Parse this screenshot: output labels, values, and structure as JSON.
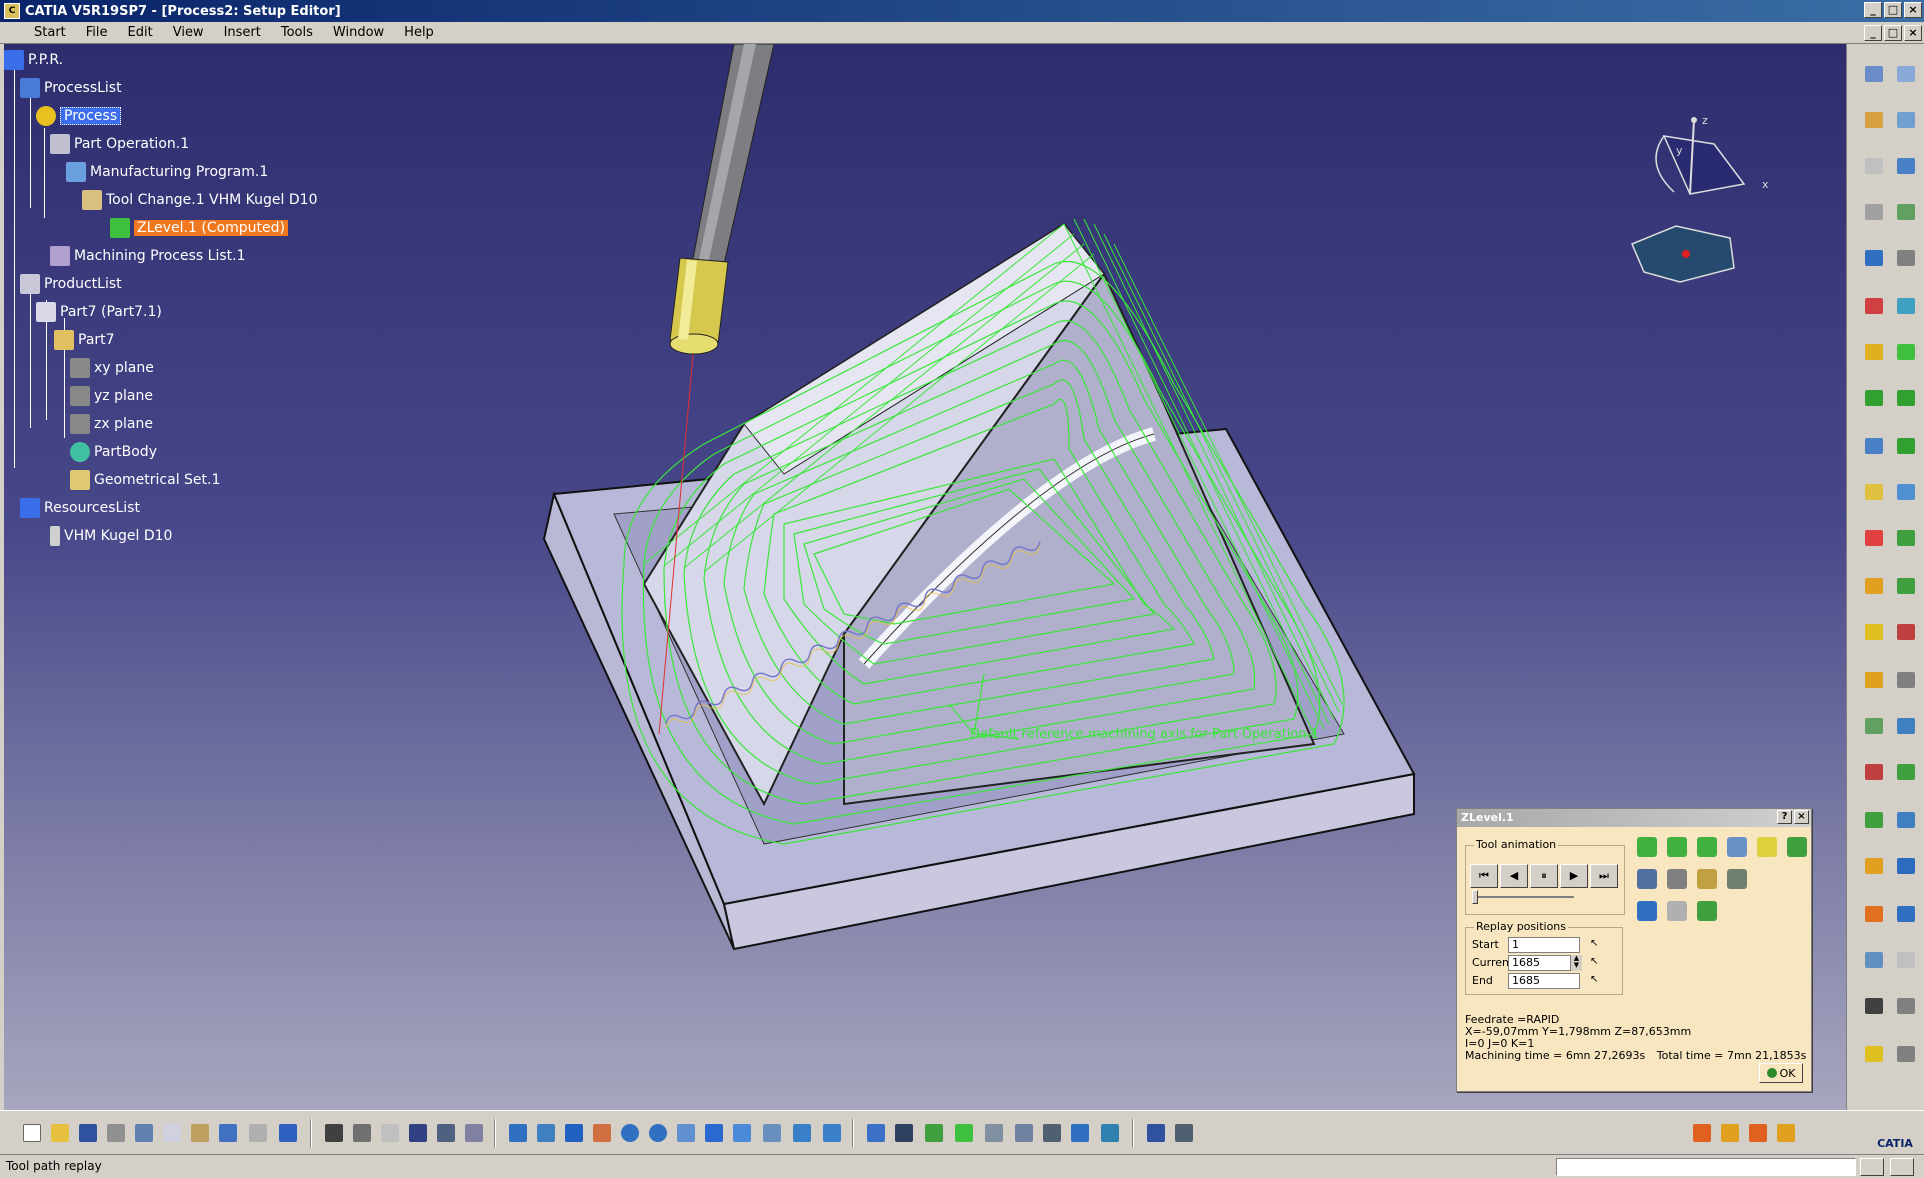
{
  "window": {
    "title": "CATIA V5R19SP7 - [Process2: Setup Editor]",
    "app_icon": "catia-app-icon",
    "controls": [
      "_",
      "□",
      "×"
    ],
    "doc_controls": [
      "_",
      "□",
      "×"
    ]
  },
  "menubar": {
    "items": [
      "Start",
      "File",
      "Edit",
      "View",
      "Insert",
      "Tools",
      "Window",
      "Help"
    ]
  },
  "tree": {
    "nodes": [
      {
        "label": "P.P.R.",
        "icon": "ppr-icon"
      },
      {
        "label": "ProcessList",
        "icon": "process-list-icon"
      },
      {
        "label": "Process",
        "icon": "process-icon",
        "state": "selected"
      },
      {
        "label": "Part Operation.1",
        "icon": "part-operation-icon"
      },
      {
        "label": "Manufacturing Program.1",
        "icon": "manufacturing-program-icon"
      },
      {
        "label": "Tool Change.1  VHM Kugel D10",
        "icon": "tool-change-icon"
      },
      {
        "label": "ZLevel.1 (Computed)",
        "icon": "zlevel-icon",
        "state": "computed"
      },
      {
        "label": "Machining Process List.1",
        "icon": "machining-process-list-icon"
      },
      {
        "label": "ProductList",
        "icon": "product-list-icon"
      },
      {
        "label": "Part7 (Part7.1)",
        "icon": "part-instance-icon"
      },
      {
        "label": "Part7",
        "icon": "part-icon"
      },
      {
        "label": "xy plane",
        "icon": "plane-icon"
      },
      {
        "label": "yz plane",
        "icon": "plane-icon"
      },
      {
        "label": "zx plane",
        "icon": "plane-icon"
      },
      {
        "label": "PartBody",
        "icon": "partbody-icon"
      },
      {
        "label": "Geometrical Set.1",
        "icon": "geometrical-set-icon"
      },
      {
        "label": "ResourcesList",
        "icon": "resources-list-icon"
      },
      {
        "label": "VHM Kugel D10",
        "icon": "tool-icon"
      }
    ]
  },
  "viewport": {
    "axis_annotation": "Default reference machining axis for Part Operation.1",
    "compass": {
      "x": "x",
      "y": "y",
      "z": "z"
    },
    "colors": {
      "toolpath": "#39e639",
      "part_face": "#c8c8e0",
      "tool_tip": "#e8e070",
      "tool_shank": "#808080"
    }
  },
  "dialog": {
    "title": "ZLevel.1",
    "help_btn": "?",
    "close_btn": "×",
    "animation": {
      "group_label": "Tool animation",
      "buttons": [
        "⏮",
        "◀",
        "⏸",
        "▶",
        "⏭"
      ],
      "slider_position": 0.0
    },
    "replay": {
      "group_label": "Replay positions",
      "start_label": "Start",
      "start_value": "1",
      "current_label": "Current",
      "current_value": "1685",
      "end_label": "End",
      "end_value": "1685"
    },
    "info": {
      "feedrate": "Feedrate =RAPID",
      "position": "X=-59,07mm Y=1,798mm Z=87,653mm",
      "ijk": "I=0 J=0 K=1",
      "machining_time": "Machining time = 6mn 27,2693s",
      "total_time": "Total time = 7mn 21,1853s"
    },
    "ok_label": "OK"
  },
  "statusbar": {
    "text": "Tool path replay"
  },
  "brand": "CATIA"
}
